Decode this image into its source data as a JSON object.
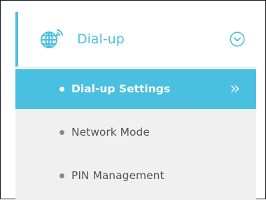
{
  "menu": {
    "header": {
      "label": "Dial-up",
      "icon": "globe-signal-icon",
      "expand_icon": "chevron-down-circle-icon",
      "expanded": true
    },
    "items": [
      {
        "label": "Dial-up Settings",
        "active": true,
        "icon": "double-chevron-right-icon"
      },
      {
        "label": "Network Mode",
        "active": false
      },
      {
        "label": "PIN Management",
        "active": false
      }
    ]
  },
  "colors": {
    "accent": "#4ac0e0",
    "panel_bg": "#f0f0f0",
    "item_text": "#555555",
    "bullet": "#888888"
  }
}
